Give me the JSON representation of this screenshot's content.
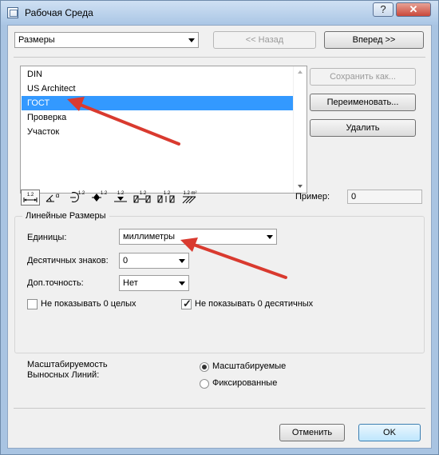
{
  "window": {
    "title": "Рабочая Среда"
  },
  "nav": {
    "dropdown_value": "Размеры",
    "back_label": "<< Назад",
    "forward_label": "Вперед >>"
  },
  "schemes": {
    "items": [
      {
        "label": "DIN"
      },
      {
        "label": "US Architect"
      },
      {
        "label": "ГОСТ"
      },
      {
        "label": "Проверка"
      },
      {
        "label": "Участок"
      }
    ],
    "selected_index": 2,
    "save_as_label": "Сохранить как...",
    "rename_label": "Переименовать...",
    "delete_label": "Удалить"
  },
  "toolbar": {
    "tools": [
      {
        "name": "linear-dimension-tool-icon",
        "caption": "1.2"
      },
      {
        "name": "angle-dimension-tool-icon",
        "caption": "α"
      },
      {
        "name": "radial-dimension-tool-icon",
        "caption": "1.2"
      },
      {
        "name": "level-dimension-tool-icon",
        "caption": "1.2"
      },
      {
        "name": "elevation-dimension-tool-icon",
        "caption": "1.2"
      },
      {
        "name": "door-window-dimension-tool-icon",
        "caption": "1.2"
      },
      {
        "name": "sill-height-dimension-tool-icon",
        "caption": "1.2"
      },
      {
        "name": "area-dimension-tool-icon",
        "caption": "1.2 m²"
      }
    ],
    "example_label": "Пример:",
    "example_value": "0"
  },
  "linear": {
    "group_title": "Линейные Размеры",
    "units_label": "Единицы:",
    "units_value": "миллиметры",
    "decimals_label": "Десятичных знаков:",
    "decimals_value": "0",
    "extra_precision_label": "Доп.точность:",
    "extra_precision_value": "Нет",
    "hide_zero_whole_label": "Не показывать 0 целых",
    "hide_zero_whole_checked": false,
    "hide_zero_decimal_label": "Не показывать 0 десятичных",
    "hide_zero_decimal_checked": true
  },
  "scaling": {
    "label_line1": "Масштабируемость",
    "label_line2": "Выносных Линий:",
    "option_scalable": "Масштабируемые",
    "option_fixed": "Фиксированные",
    "selected": "Масштабируемые"
  },
  "footer": {
    "cancel_label": "Отменить",
    "ok_label": "OK"
  },
  "colors": {
    "selection": "#3399ff",
    "annotation_arrow": "#d93a2f",
    "window_frame": "#a9c4e2"
  }
}
